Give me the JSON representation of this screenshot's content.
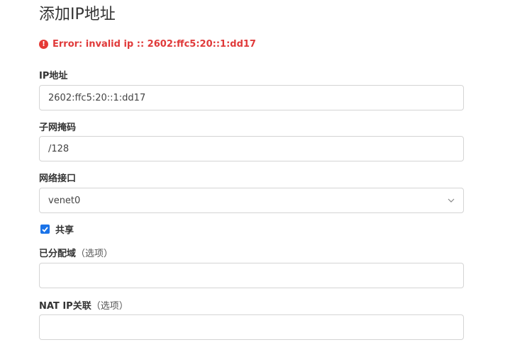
{
  "page": {
    "title": "添加IP地址"
  },
  "error": {
    "icon": "exclamation-circle-icon",
    "message": "Error: invalid ip :: 2602:ffc5:20::1:dd17",
    "color": "#e03a3a"
  },
  "form": {
    "ip_address": {
      "label": "IP地址",
      "value": "2602:ffc5:20::1:dd17"
    },
    "subnet_mask": {
      "label": "子网掩码",
      "value": "/128"
    },
    "network_interface": {
      "label": "网络接口",
      "selected": "venet0",
      "icon": "chevron-down-icon"
    },
    "shared": {
      "label": "共享",
      "checked": true,
      "color": "#1a73e8"
    },
    "assigned_domain": {
      "label": "已分配域",
      "optional": "（选项）",
      "value": ""
    },
    "nat_ip": {
      "label": "NAT IP关联",
      "optional": "（选项）",
      "value": ""
    }
  }
}
